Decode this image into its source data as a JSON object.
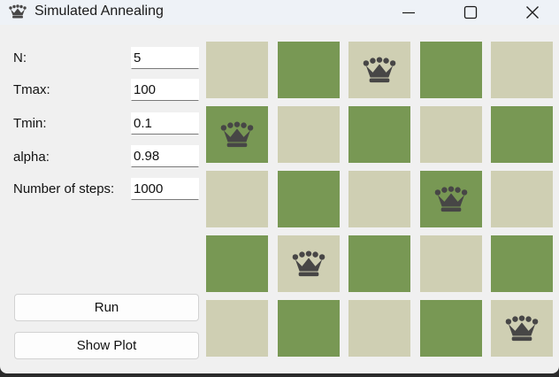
{
  "window": {
    "title": "Simulated Annealing",
    "app_icon": "queen-icon",
    "controls": [
      "minimize-icon",
      "maximize-icon",
      "close-icon"
    ]
  },
  "form": {
    "fields": [
      {
        "label": "N:",
        "value": "5"
      },
      {
        "label": "Tmax:",
        "value": "100"
      },
      {
        "label": "Tmin:",
        "value": "0.1"
      },
      {
        "label": "alpha:",
        "value": "0.98"
      },
      {
        "label": "Number of steps:",
        "value": "1000"
      }
    ]
  },
  "buttons": {
    "run_label": "Run",
    "show_plot_label": "Show Plot"
  },
  "board": {
    "size": 5,
    "queen_columns_by_row": [
      2,
      0,
      3,
      1,
      4
    ],
    "light_color": "#cfcfb3",
    "dark_color": "#789854",
    "piece_icon": "queen-icon"
  },
  "colors": {
    "queen": "#474646",
    "background": "#f0f0f0",
    "titlebar": "#eef2f7"
  }
}
